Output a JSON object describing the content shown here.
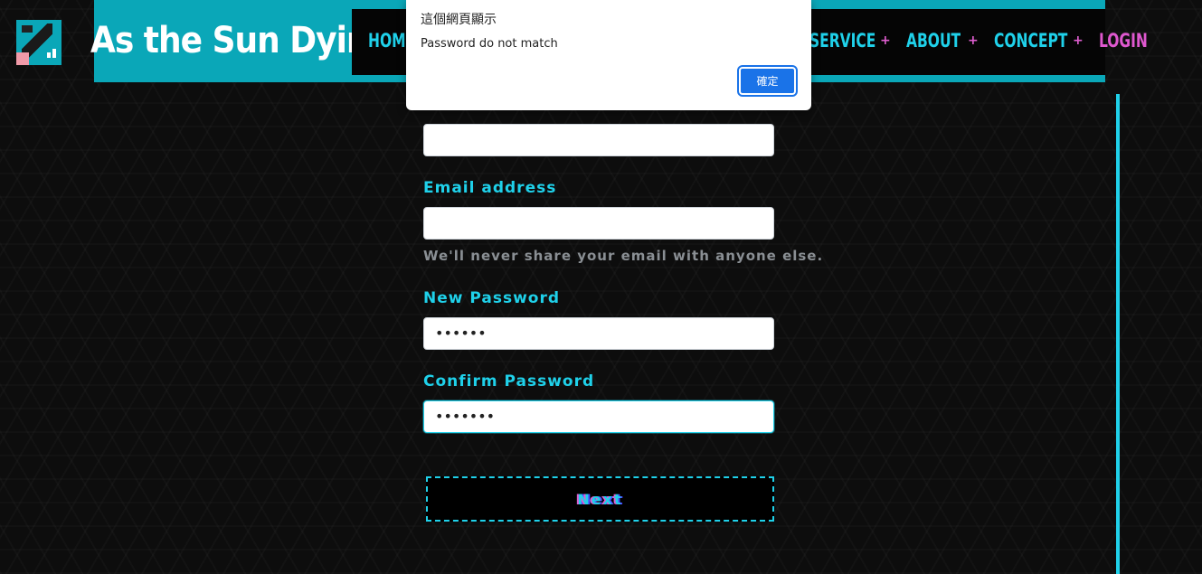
{
  "header": {
    "brand": "As the Sun Dying",
    "nav": [
      {
        "label": "HOME"
      },
      {
        "label": "SERVICE"
      },
      {
        "label": "ABOUT"
      },
      {
        "label": "CONCEPT"
      },
      {
        "label": "LOGIN"
      }
    ],
    "separator": "+"
  },
  "form": {
    "email_label": "Email address",
    "email_help": "We'll never share your email with anyone else.",
    "new_password_label": "New Password",
    "new_password_value": "••••••",
    "confirm_password_label": "Confirm Password",
    "confirm_password_value": "•••••••",
    "next_label": "Next"
  },
  "dialog": {
    "title": "這個網頁顯示",
    "message": "Password do not match",
    "ok_label": "確定"
  },
  "colors": {
    "accent": "#1fd1ea",
    "teal": "#0aa7b8",
    "pink": "#df58cf",
    "dialog_button": "#1a73e8"
  }
}
